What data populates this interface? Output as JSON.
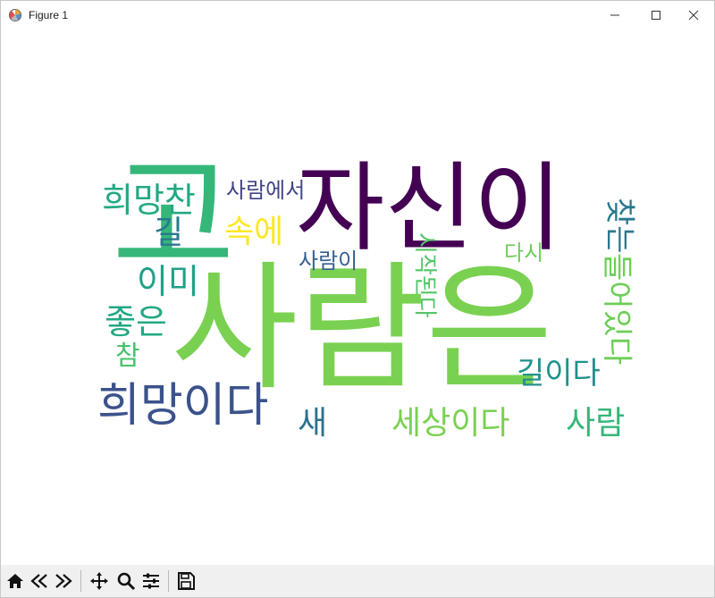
{
  "window": {
    "title": "Figure 1",
    "icon": "matplotlib-figure-icon",
    "controls": [
      "minimize-icon",
      "maximize-icon",
      "close-icon"
    ]
  },
  "wordcloud": {
    "background": "#ffffff",
    "words": [
      {
        "text": "고",
        "color": "#35b779"
      },
      {
        "text": "자신이",
        "color": "#440154"
      },
      {
        "text": "사람은",
        "color": "#7ad151"
      },
      {
        "text": "희망찬",
        "color": "#22a884"
      },
      {
        "text": "사람에서",
        "color": "#414487"
      },
      {
        "text": "길",
        "color": "#2a788e"
      },
      {
        "text": "속에",
        "color": "#fde725"
      },
      {
        "text": "사람이",
        "color": "#355f8d"
      },
      {
        "text": "시작된다",
        "color": "#54c568"
      },
      {
        "text": "다시",
        "color": "#6ece58"
      },
      {
        "text": "찾는",
        "color": "#2a788e"
      },
      {
        "text": "이미",
        "color": "#1fa187"
      },
      {
        "text": "좋은",
        "color": "#22a884"
      },
      {
        "text": "들어있다",
        "color": "#6ece58"
      },
      {
        "text": "참",
        "color": "#4ac16d"
      },
      {
        "text": "길이다",
        "color": "#21918c"
      },
      {
        "text": "희망이다",
        "color": "#3b528b"
      },
      {
        "text": "새",
        "color": "#2c728e"
      },
      {
        "text": "세상이다",
        "color": "#7ad151"
      },
      {
        "text": "사람",
        "color": "#35b779"
      }
    ]
  },
  "toolbar": {
    "buttons": [
      {
        "name": "home-icon",
        "label": "Home"
      },
      {
        "name": "back-icon",
        "label": "Back"
      },
      {
        "name": "forward-icon",
        "label": "Forward"
      },
      {
        "name": "pan-icon",
        "label": "Pan"
      },
      {
        "name": "zoom-icon",
        "label": "Zoom"
      },
      {
        "name": "subplots-icon",
        "label": "Configure subplots"
      },
      {
        "name": "save-icon",
        "label": "Save"
      }
    ]
  }
}
